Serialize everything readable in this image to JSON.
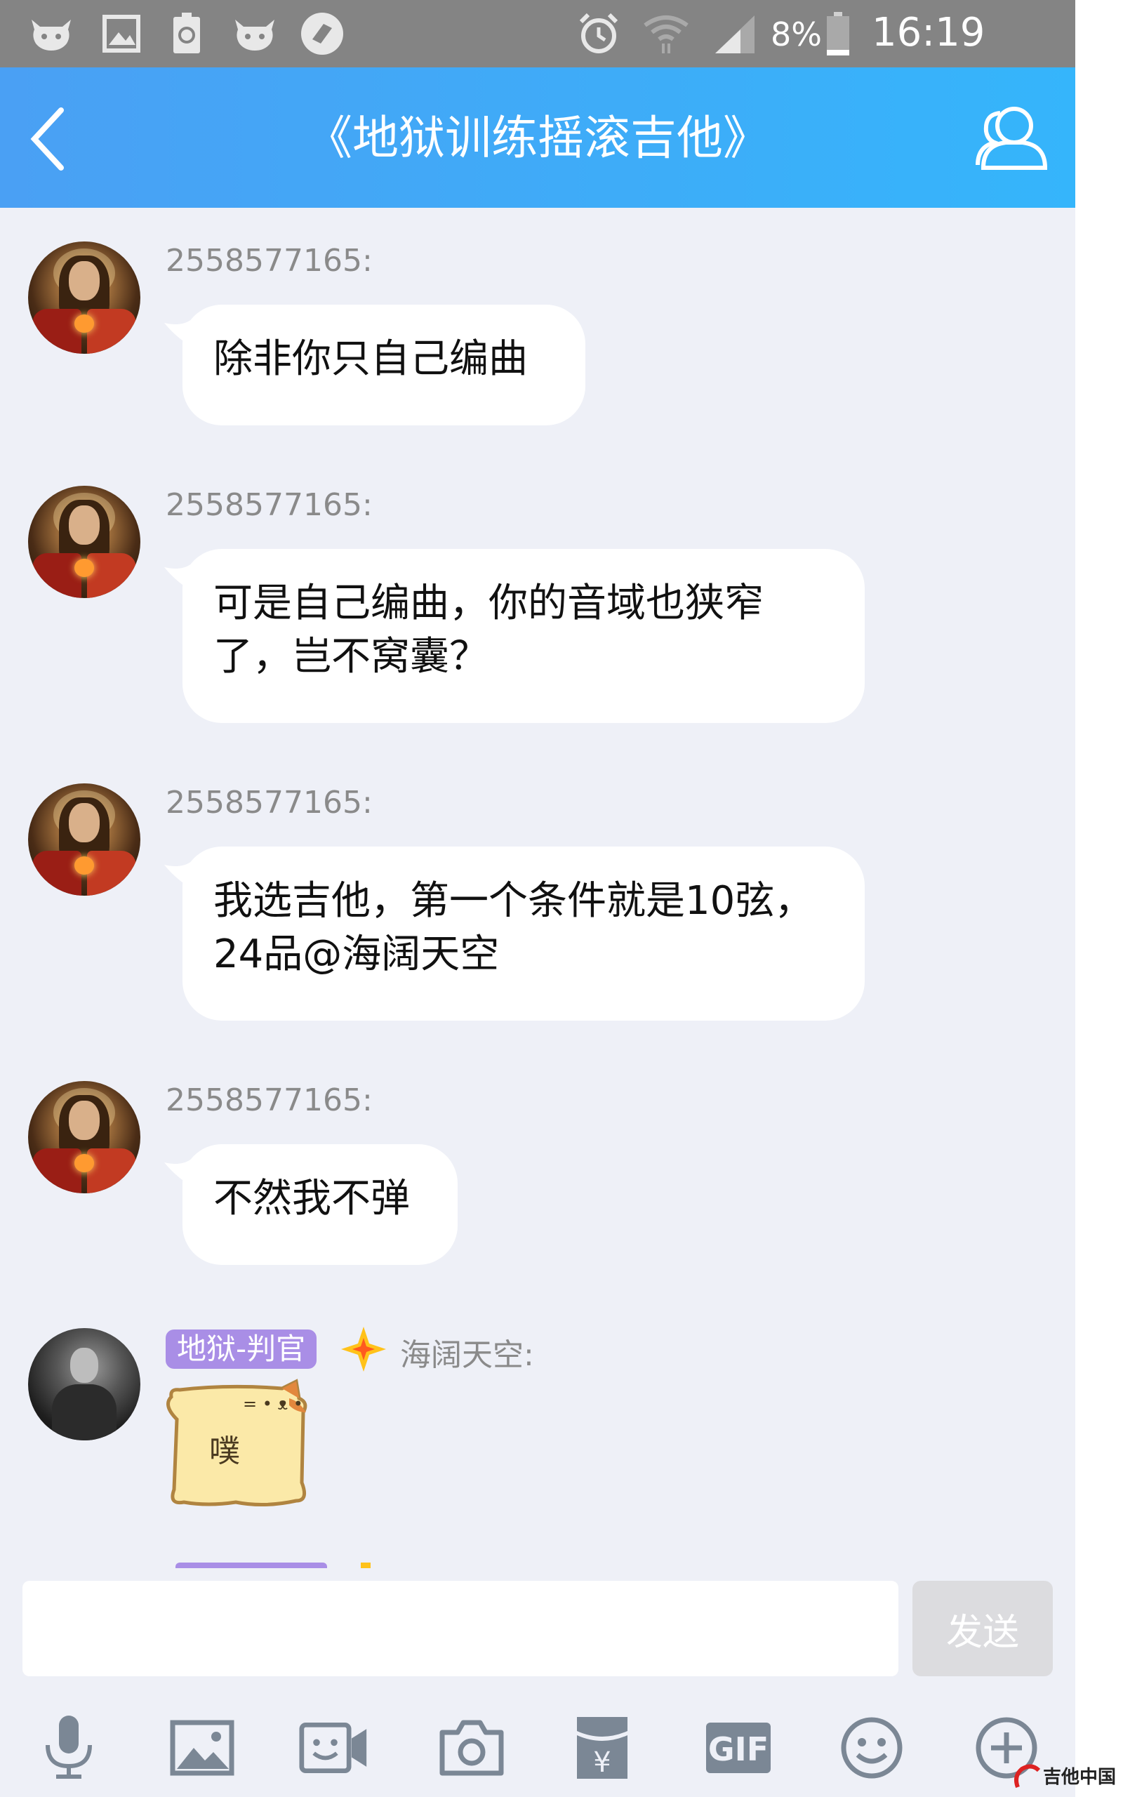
{
  "status_bar": {
    "battery": "8%",
    "time": "16:19"
  },
  "header": {
    "title": "《地狱训练摇滚吉他》"
  },
  "messages": [
    {
      "sender": "2558577165:",
      "text": "除非你只自己编曲"
    },
    {
      "sender": "2558577165:",
      "text": "可是自己编曲，你的音域也狭窄了，岂不窝囊？"
    },
    {
      "sender": "2558577165:",
      "text": "我选吉他，第一个条件就是10弦，24品@海阔天空"
    },
    {
      "sender": "2558577165:",
      "text": "不然我不弹"
    },
    {
      "badge": "地狱-判官",
      "sender": "海阔天空:",
      "sticker_text": "噗"
    }
  ],
  "input": {
    "value": "",
    "send_label": "发送"
  },
  "toolbar": {
    "icons": [
      "microphone-icon",
      "image-icon",
      "video-call-icon",
      "camera-icon",
      "red-packet-icon",
      "gif-icon",
      "emoji-icon",
      "plus-icon"
    ],
    "gif_label": "GIF"
  },
  "watermark": {
    "text": "吉他中国"
  },
  "colors": {
    "header_gradient_start": "#4aa0f4",
    "header_gradient_end": "#35b5fb",
    "status_bar": "#848484",
    "chat_bg": "#eef0f7",
    "badge": "#a98ee6",
    "bubble": "#ffffff"
  }
}
